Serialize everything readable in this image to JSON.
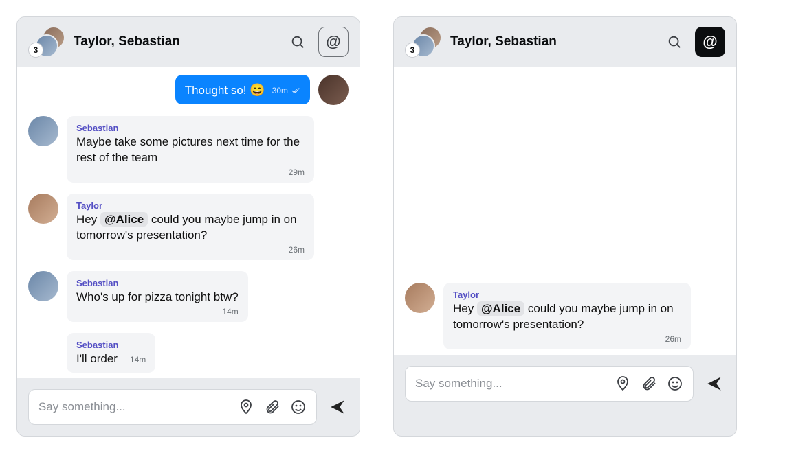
{
  "header": {
    "title": "Taylor, Sebastian",
    "participant_count": "3"
  },
  "left": {
    "messages": {
      "m0": {
        "text": "Thought so!",
        "emoji": "😄",
        "time": "30m"
      },
      "m1": {
        "sender": "Sebastian",
        "text": "Maybe take some pictures next time for the rest of the team",
        "time": "29m"
      },
      "m2": {
        "sender": "Taylor",
        "before": "Hey ",
        "mention": "@Alice",
        "after": " could you maybe jump in on tomorrow's presentation?",
        "time": "26m"
      },
      "m3": {
        "sender": "Sebastian",
        "text": "Who's up for pizza tonight btw?",
        "time": "14m"
      },
      "m4": {
        "sender": "Sebastian",
        "text": "I'll order",
        "time": "14m"
      }
    }
  },
  "right": {
    "messages": {
      "m0": {
        "sender": "Taylor",
        "before": "Hey ",
        "mention": "@Alice",
        "after": " could you maybe jump in on tomorrow's presentation?",
        "time": "26m"
      }
    }
  },
  "composer": {
    "placeholder": "Say something..."
  }
}
